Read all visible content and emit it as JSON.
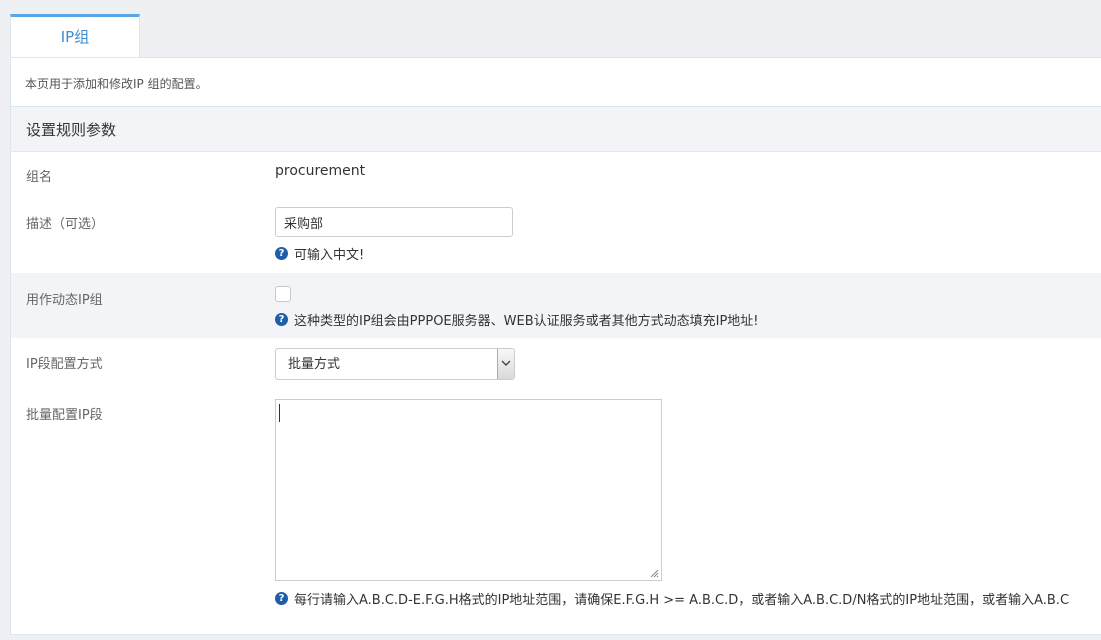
{
  "tabs": [
    {
      "label": "IP组",
      "active": true
    }
  ],
  "intro_text": "本页用于添加和修改IP 组的配置。",
  "section_title": "设置规则参数",
  "fields": {
    "group_name": {
      "label": "组名",
      "value": "procurement"
    },
    "description": {
      "label": "描述（可选）",
      "value": "采购部",
      "hint": "可输入中文!"
    },
    "dynamic": {
      "label": "用作动态IP组",
      "checked": false,
      "hint": "这种类型的IP组会由PPPOE服务器、WEB认证服务或者其他方式动态填充IP地址!"
    },
    "ip_mode": {
      "label": "IP段配置方式",
      "selected": "批量方式"
    },
    "batch_ip": {
      "label": "批量配置IP段",
      "value": "",
      "hint": "每行请输入A.B.C.D-E.F.G.H格式的IP地址范围，请确保E.F.G.H >= A.B.C.D，或者输入A.B.C.D/N格式的IP地址范围，或者输入A.B.C"
    }
  },
  "icons": {
    "hint": "question-circle-icon",
    "select": "chevron-down-icon",
    "resize": "resize-grip-icon"
  },
  "colors": {
    "accent": "#3c8dd0",
    "tab_border": "#5aa6e6",
    "hint_icon": "#1e5ea8",
    "row_alt": "#f3f4f7"
  }
}
